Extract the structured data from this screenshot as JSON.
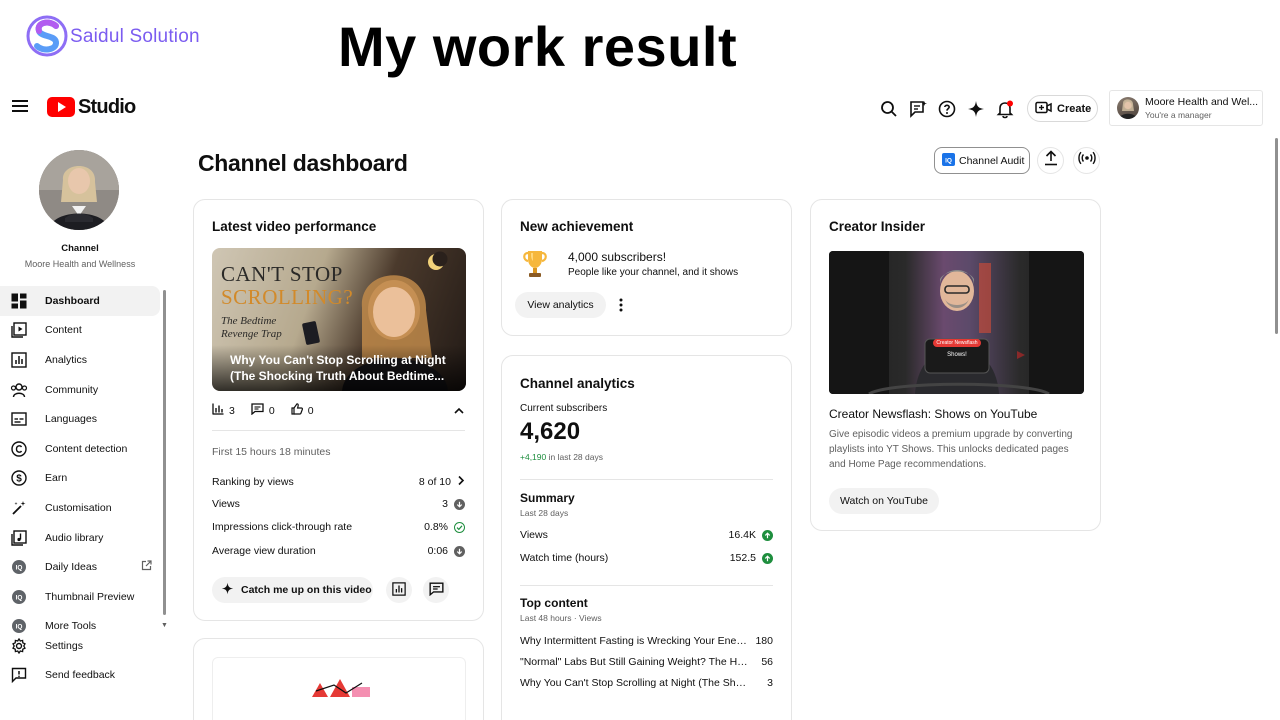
{
  "banner": {
    "brand": "Saidul Solution",
    "title": "My work result"
  },
  "topbar": {
    "studio_label": "Studio",
    "create_label": "Create",
    "account_name": "Moore Health and Wel...",
    "account_role": "You're a manager"
  },
  "sidebar": {
    "channel_label": "Channel",
    "channel_name": "Moore Health and Wellness",
    "items": [
      {
        "label": "Dashboard",
        "icon": "dashboard-icon"
      },
      {
        "label": "Content",
        "icon": "content-icon"
      },
      {
        "label": "Analytics",
        "icon": "analytics-icon"
      },
      {
        "label": "Community",
        "icon": "community-icon"
      },
      {
        "label": "Languages",
        "icon": "subtitles-icon"
      },
      {
        "label": "Content detection",
        "icon": "copyright-icon"
      },
      {
        "label": "Earn",
        "icon": "dollar-icon"
      },
      {
        "label": "Customisation",
        "icon": "magic-wand-icon"
      },
      {
        "label": "Audio library",
        "icon": "audio-library-icon"
      },
      {
        "label": "Daily Ideas",
        "icon": "iq-icon"
      },
      {
        "label": "Thumbnail Preview",
        "icon": "iq-icon"
      },
      {
        "label": "More Tools",
        "icon": "iq-icon"
      }
    ],
    "settings_label": "Settings",
    "feedback_label": "Send feedback"
  },
  "main": {
    "title": "Channel dashboard",
    "audit_label": "Channel Audit"
  },
  "latest_video": {
    "title": "Latest video performance",
    "thumb_line1": "CAN'T STOP",
    "thumb_line2": "SCROLLING?",
    "thumb_line3": "The Bedtime",
    "thumb_line4": "Revenge Trap",
    "caption": "Why You Can't Stop Scrolling at Night (The Shocking Truth About Bedtime...",
    "views_count": "3",
    "comments_count": "0",
    "likes_count": "0",
    "period": "First 15 hours 18 minutes",
    "metrics": [
      {
        "label": "Ranking by views",
        "value": "8 of 10"
      },
      {
        "label": "Views",
        "value": "3"
      },
      {
        "label": "Impressions click-through rate",
        "value": "0.8%"
      },
      {
        "label": "Average view duration",
        "value": "0:06"
      }
    ],
    "catch_up_label": "Catch me up on this video"
  },
  "achievement": {
    "title": "New achievement",
    "headline": "4,000 subscribers!",
    "subtitle": "People like your channel, and it shows",
    "button_label": "View analytics"
  },
  "analytics": {
    "title": "Channel analytics",
    "subs_label": "Current subscribers",
    "subs_value": "4,620",
    "subs_change": "+4,190",
    "subs_change_suffix": "in last 28 days",
    "summary_title": "Summary",
    "summary_period": "Last 28 days",
    "summary_rows": [
      {
        "label": "Views",
        "value": "16.4K"
      },
      {
        "label": "Watch time (hours)",
        "value": "152.5"
      }
    ],
    "top_title": "Top content",
    "top_period": "Last 48 hours · Views",
    "top_rows": [
      {
        "title": "Why Intermittent Fasting is Wrecking Your Energ...",
        "views": "180"
      },
      {
        "title": "\"Normal\" Labs But Still Gaining Weight? The Hidd...",
        "views": "56"
      },
      {
        "title": "Why You Can't Stop Scrolling at Night (The Shoc...",
        "views": "3"
      }
    ]
  },
  "insider": {
    "title": "Creator Insider",
    "thumb_badge": "Creator Newsflash",
    "thumb_card": "Shows!",
    "video_title": "Creator Newsflash: Shows on YouTube",
    "description": "Give episodic videos a premium upgrade by converting playlists into YT Shows. This unlocks dedicated pages and Home Page recommendations.",
    "button_label": "Watch on YouTube"
  },
  "colors": {
    "accent_red": "#ff0000",
    "positive_green": "#1e8e3e",
    "brand_purple": "#7b5cf0"
  }
}
